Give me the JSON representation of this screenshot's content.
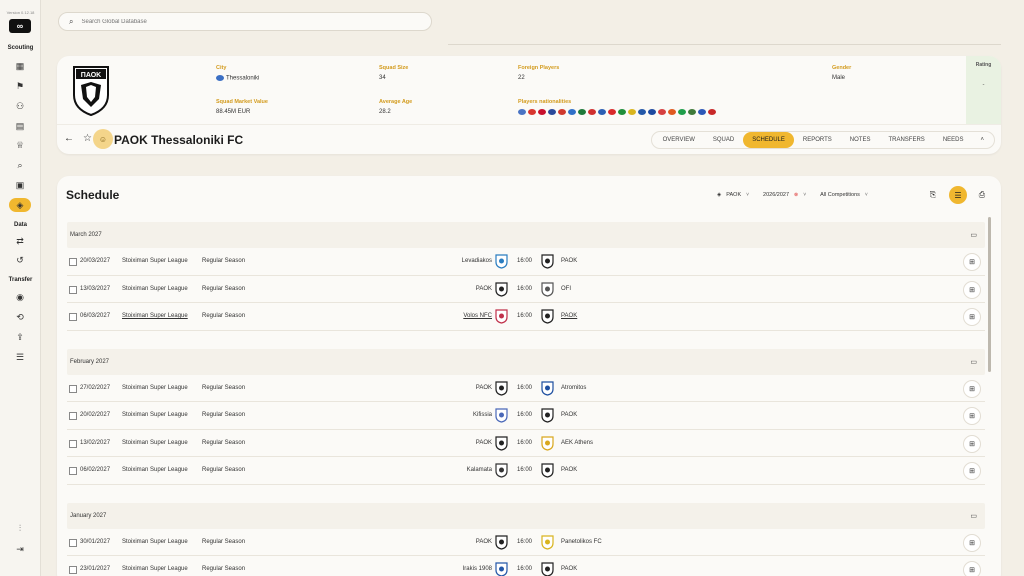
{
  "app": {
    "version": "Version 0.12.18"
  },
  "sidebar": {
    "sections": [
      "Scouting",
      "Data",
      "Transfer"
    ],
    "scouting_icons": [
      "dashboard-icon",
      "running-icon",
      "players-icon",
      "reports-icon",
      "trophy-icon",
      "search-scout-icon",
      "calendar-icon",
      "shield-icon"
    ],
    "data_icons": [
      "exchange-icon",
      "history-icon"
    ],
    "transfer_icons": [
      "shield-check-icon",
      "transfer-icon",
      "upload-icon",
      "list-icon"
    ],
    "bottom_icons": [
      "settings-sliders-icon",
      "logout-icon"
    ]
  },
  "search": {
    "placeholder": "Search Global Database"
  },
  "club": {
    "name": "PAOK Thessaloniki FC",
    "crest_text": "ΠΑΟΚ",
    "city_label": "City",
    "city": "Thessaloniki",
    "squad_size_label": "Squad Size",
    "squad_size": "34",
    "foreign_label": "Foreign Players",
    "foreign": "22",
    "gender_label": "Gender",
    "gender": "Male",
    "market_label": "Squad Market Value",
    "market": "88.45M EUR",
    "age_label": "Average Age",
    "age": "28.2",
    "nationalities_label": "Players nationalities",
    "rating_label": "Rating",
    "rating": "-",
    "nationality_colors": [
      "#4a74c4",
      "#d8362f",
      "#c8102e",
      "#2b4a9b",
      "#d03a2f",
      "#3070c8",
      "#1f7a3a",
      "#d03030",
      "#2c5fb4",
      "#d92b2b",
      "#1f8f3a",
      "#d9b51f",
      "#2458a8",
      "#1e4aa0",
      "#d64040",
      "#e05a20",
      "#1f9e4a",
      "#3f7a3a",
      "#2d58b8",
      "#c82828"
    ]
  },
  "tabs": [
    "OVERVIEW",
    "SQUAD",
    "SCHEDULE",
    "REPORTS",
    "NOTES",
    "TRANSFERS",
    "NEEDS"
  ],
  "active_tab": "SCHEDULE",
  "schedule": {
    "title": "Schedule",
    "filters": {
      "team": "PAOK",
      "season": "2026/2027",
      "competition": "All Competitions"
    },
    "months": [
      {
        "label": "March 2027",
        "matches": [
          {
            "date": "20/03/2027",
            "competition": "Stoiximan Super League",
            "stage": "Regular Season",
            "home": "Levadiakos",
            "time": "16:00",
            "away": "PAOK"
          },
          {
            "date": "13/03/2027",
            "competition": "Stoiximan Super League",
            "stage": "Regular Season",
            "home": "PAOK",
            "time": "16:00",
            "away": "OFI"
          },
          {
            "date": "06/03/2027",
            "competition": "Stoiximan Super League",
            "stage": "Regular Season",
            "home": "Volos NFC",
            "time": "16:00",
            "away": "PAOK"
          }
        ]
      },
      {
        "label": "February 2027",
        "matches": [
          {
            "date": "27/02/2027",
            "competition": "Stoiximan Super League",
            "stage": "Regular Season",
            "home": "PAOK",
            "time": "16:00",
            "away": "Atromitos"
          },
          {
            "date": "20/02/2027",
            "competition": "Stoiximan Super League",
            "stage": "Regular Season",
            "home": "Kifissia",
            "time": "16:00",
            "away": "PAOK"
          },
          {
            "date": "13/02/2027",
            "competition": "Stoiximan Super League",
            "stage": "Regular Season",
            "home": "PAOK",
            "time": "16:00",
            "away": "AEK Athens"
          },
          {
            "date": "06/02/2027",
            "competition": "Stoiximan Super League",
            "stage": "Regular Season",
            "home": "Kalamata",
            "time": "16:00",
            "away": "PAOK"
          }
        ]
      },
      {
        "label": "January 2027",
        "matches": [
          {
            "date": "30/01/2027",
            "competition": "Stoiximan Super League",
            "stage": "Regular Season",
            "home": "PAOK",
            "time": "16:00",
            "away": "Panetolikos FC"
          },
          {
            "date": "23/01/2027",
            "competition": "Stoiximan Super League",
            "stage": "Regular Season",
            "home": "Irakis 1908",
            "time": "16:00",
            "away": "PAOK"
          }
        ]
      }
    ]
  },
  "colors": {
    "accent": "#f0b72f",
    "label": "#d39b1d",
    "bg": "#f3efe6",
    "card": "#fbfaf7"
  }
}
